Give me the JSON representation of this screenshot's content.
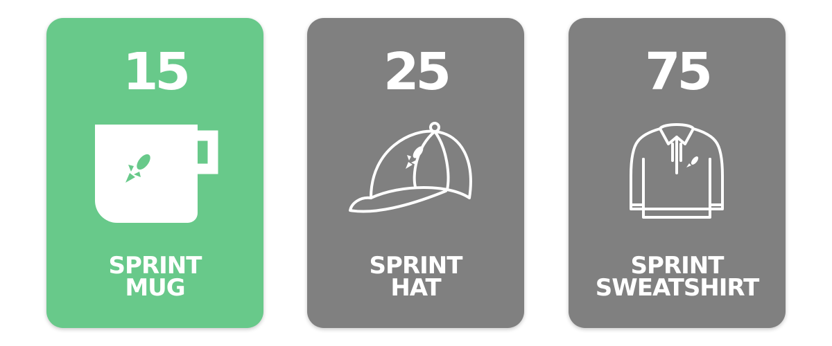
{
  "colors": {
    "active": "#68c98a",
    "inactive": "#808080",
    "text": "#ffffff"
  },
  "rewards": [
    {
      "points": "15",
      "line1": "SPRINT",
      "line2": "MUG",
      "icon": "mug-icon",
      "active": true
    },
    {
      "points": "25",
      "line1": "SPRINT",
      "line2": "HAT",
      "icon": "cap-icon",
      "active": false
    },
    {
      "points": "75",
      "line1": "SPRINT",
      "line2": "SWEATSHIRT",
      "icon": "sweatshirt-icon",
      "active": false
    }
  ]
}
